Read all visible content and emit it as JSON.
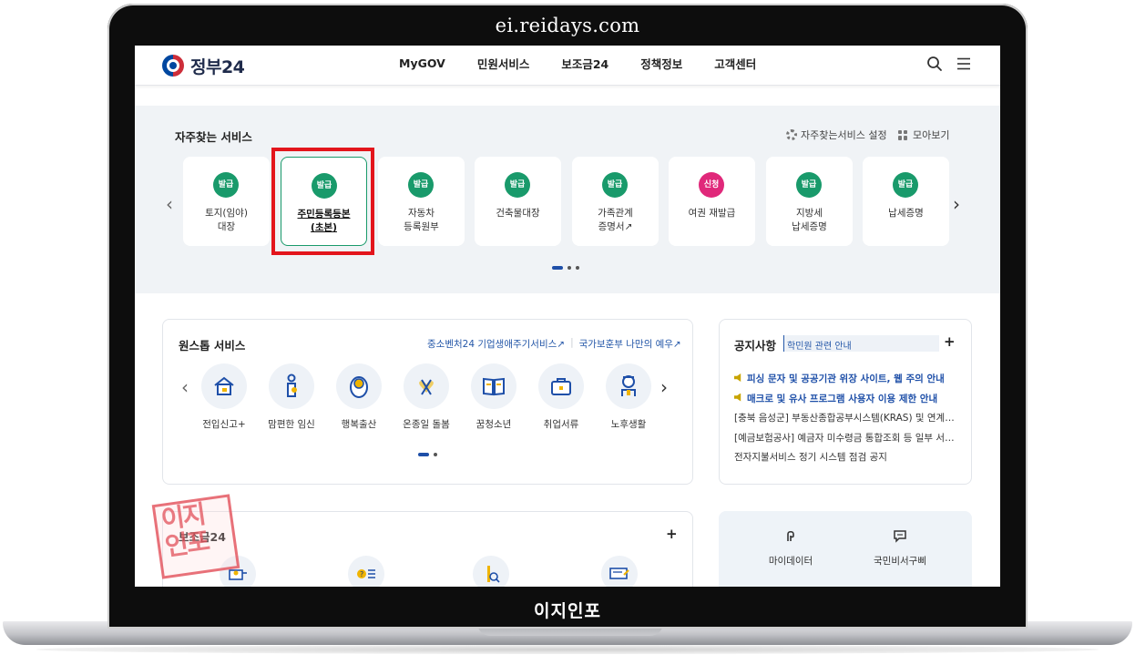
{
  "bezel": {
    "title": "ei.reidays.com",
    "footer_text": "이지인포"
  },
  "header": {
    "logo_text": "정부24",
    "nav": [
      "MyGOV",
      "민원서비스",
      "보조금24",
      "정책정보",
      "고객센터"
    ],
    "search_icon": "search-icon",
    "menu_icon": "hamburger-menu-icon"
  },
  "frequent": {
    "title": "자주찾는 서비스",
    "setting_label": "자주찾는서비스 설정",
    "view_all_label": "모아보기",
    "cards": [
      {
        "badge": "발급",
        "label": "토지(임야)\n대장"
      },
      {
        "badge": "발급",
        "label": "주민등록등본\n(초본)",
        "active": true
      },
      {
        "badge": "발급",
        "label": "자동차\n등록원부"
      },
      {
        "badge": "발급",
        "label": "건축물대장"
      },
      {
        "badge": "발급",
        "label": "가족관계\n증명서↗"
      },
      {
        "badge": "신청",
        "label": "여권 재발급"
      },
      {
        "badge": "발급",
        "label": "지방세\n납세증명"
      },
      {
        "badge": "발급",
        "label": "납세증명"
      }
    ]
  },
  "onestop": {
    "title": "원스톱 서비스",
    "links": [
      "중소벤처24 기업생애주기서비스↗",
      "국가보훈부 나만의 예우↗"
    ],
    "items": [
      "전입신고+",
      "맘편한 임신",
      "행복출산",
      "온종일 돌봄",
      "꿈청소년",
      "취업서류",
      "노후생활"
    ]
  },
  "notice": {
    "title": "공지사항",
    "search_text": "학민원 관련 안내",
    "items": [
      {
        "text": "피싱 문자 및 공공기관 위장 사이트, 웹 주의 안내",
        "hot": true
      },
      {
        "text": "매크로 및 유사 프로그램 사용자 이용 제한 안내",
        "hot": true
      },
      {
        "text": "[충북 음성군] 부동산종합공부시스템(KRAS) 및 연계…",
        "hot": false
      },
      {
        "text": "[예금보험공사] 예금자 미수령금 통합조회 등 일부 서…",
        "hot": false
      },
      {
        "text": "전자지불서비스 정기 시스템 점검 공지",
        "hot": false
      }
    ]
  },
  "subsidy": {
    "title": "보조금24"
  },
  "quick": {
    "items": [
      "마이데이터",
      "국민비서구삐"
    ]
  },
  "stamp": {
    "text": "이지\n인포"
  }
}
